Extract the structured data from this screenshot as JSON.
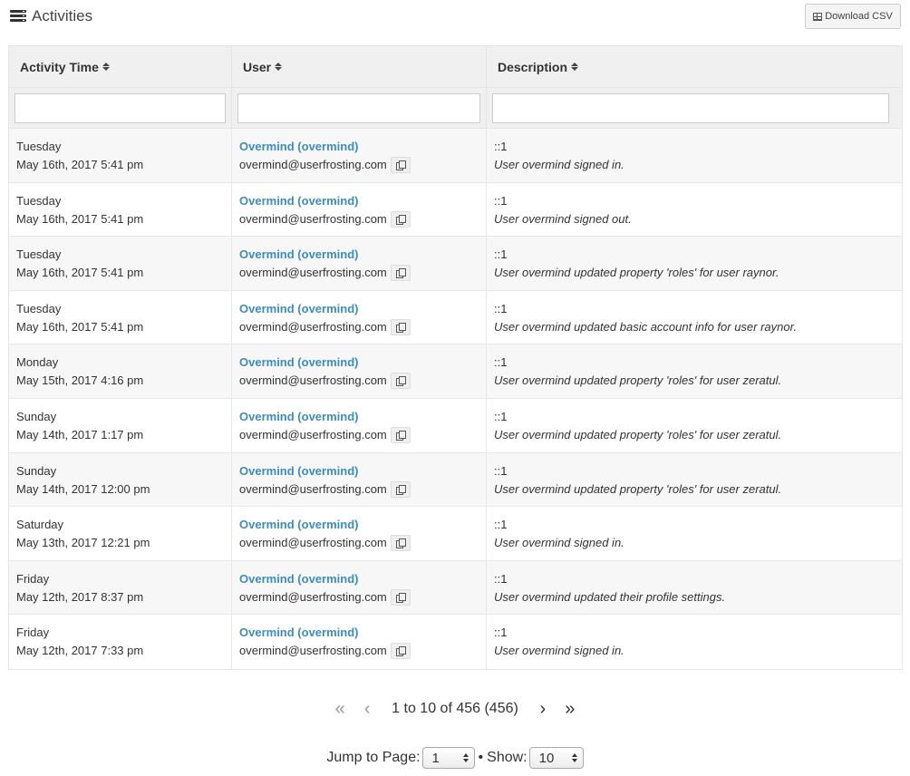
{
  "header": {
    "title": "Activities",
    "download_label": "Download CSV"
  },
  "table": {
    "columns": [
      "Activity Time",
      "User",
      "Description"
    ],
    "rows": [
      {
        "day": "Tuesday",
        "datetime": "May 16th, 2017 5:41 pm",
        "user": "Overmind (overmind)",
        "email": "overmind@userfrosting.com",
        "ip": "::1",
        "desc": "User overmind signed in."
      },
      {
        "day": "Tuesday",
        "datetime": "May 16th, 2017 5:41 pm",
        "user": "Overmind (overmind)",
        "email": "overmind@userfrosting.com",
        "ip": "::1",
        "desc": "User overmind signed out."
      },
      {
        "day": "Tuesday",
        "datetime": "May 16th, 2017 5:41 pm",
        "user": "Overmind (overmind)",
        "email": "overmind@userfrosting.com",
        "ip": "::1",
        "desc": "User overmind updated property 'roles' for user raynor."
      },
      {
        "day": "Tuesday",
        "datetime": "May 16th, 2017 5:41 pm",
        "user": "Overmind (overmind)",
        "email": "overmind@userfrosting.com",
        "ip": "::1",
        "desc": "User overmind updated basic account info for user raynor."
      },
      {
        "day": "Monday",
        "datetime": "May 15th, 2017 4:16 pm",
        "user": "Overmind (overmind)",
        "email": "overmind@userfrosting.com",
        "ip": "::1",
        "desc": "User overmind updated property 'roles' for user zeratul."
      },
      {
        "day": "Sunday",
        "datetime": "May 14th, 2017 1:17 pm",
        "user": "Overmind (overmind)",
        "email": "overmind@userfrosting.com",
        "ip": "::1",
        "desc": "User overmind updated property 'roles' for user zeratul."
      },
      {
        "day": "Sunday",
        "datetime": "May 14th, 2017 12:00 pm",
        "user": "Overmind (overmind)",
        "email": "overmind@userfrosting.com",
        "ip": "::1",
        "desc": "User overmind updated property 'roles' for user zeratul."
      },
      {
        "day": "Saturday",
        "datetime": "May 13th, 2017 12:21 pm",
        "user": "Overmind (overmind)",
        "email": "overmind@userfrosting.com",
        "ip": "::1",
        "desc": "User overmind signed in."
      },
      {
        "day": "Friday",
        "datetime": "May 12th, 2017 8:37 pm",
        "user": "Overmind (overmind)",
        "email": "overmind@userfrosting.com",
        "ip": "::1",
        "desc": "User overmind updated their profile settings."
      },
      {
        "day": "Friday",
        "datetime": "May 12th, 2017 7:33 pm",
        "user": "Overmind (overmind)",
        "email": "overmind@userfrosting.com",
        "ip": "::1",
        "desc": "User overmind signed in."
      }
    ]
  },
  "pager": {
    "info": "1 to 10 of 456 (456)",
    "first_icon": "double-chevron-left-icon",
    "prev_icon": "chevron-left-icon",
    "next_icon": "chevron-right-icon",
    "last_icon": "double-chevron-right-icon"
  },
  "footer": {
    "jump_label": "Jump to Page:",
    "page_value": "1",
    "separator": "•",
    "show_label": "Show:",
    "show_value": "10"
  },
  "colors": {
    "link": "#3c8dbc",
    "header_bg": "#f0f0f0",
    "row_alt_bg": "#f7f7f7"
  }
}
